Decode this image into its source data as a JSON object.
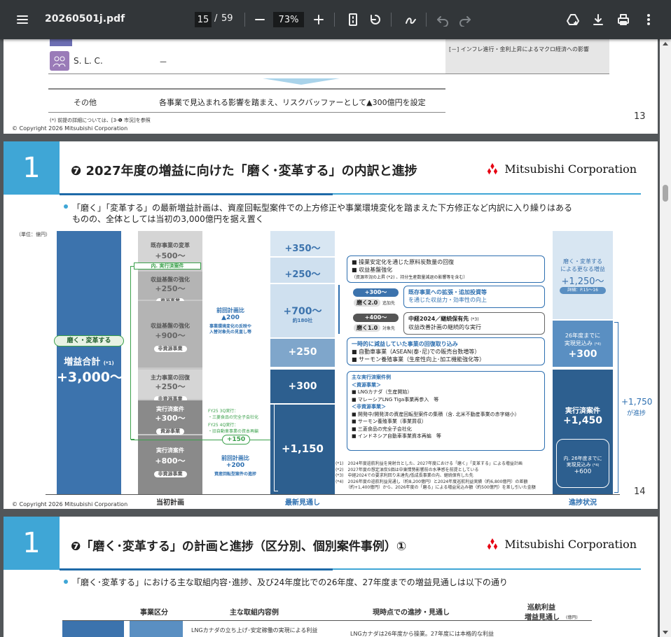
{
  "toolbar": {
    "menu_icon": "hamburger-icon",
    "filename": "20260501j.pdf",
    "page_current": "15",
    "page_sep": "/",
    "page_total": "59",
    "zoom": "73%"
  },
  "page13": {
    "slc_label": "S. L. C.",
    "slc_value": "－",
    "right_note": "[－] インフレ進行・金利上昇によるマクロ経済への影響",
    "other_label": "その他",
    "other_text": "各事業で見込まれる影響を踏まえ、リスクバッファーとして▲300億円を設定",
    "footnote": "(*) 前提の詳細については、[3-❶ 市況]を参照",
    "copyright": "© Copyright 2026 Mitsubishi Corporation",
    "page_number": "13"
  },
  "page14": {
    "section_number": "1",
    "title": "❼ 2027年度の増益に向けた「磨く･変革する」の内訳と進捗",
    "logo_text": "Mitsubishi Corporation",
    "bullet_line1": "「磨く」「変革する」の最新増益計画は、資産回転型案件での上方修正や事業環境変化を踏まえた下方修正など内訳に入り繰りはある",
    "bullet_line2": "ものの、全体としては当初の3,000億円を据え置く",
    "unit": "（単位：億円）",
    "left_badge": "磨く・変革する",
    "left_total_label": "増益合計",
    "left_total_note": "(*1)",
    "left_total_value": "+3,000～",
    "initial": [
      {
        "label": "既存事業の変革",
        "value": "+500～",
        "tag": ""
      },
      {
        "label": "内. 実行済案件",
        "value": "",
        "tag": ""
      },
      {
        "label": "収益基盤の強化",
        "value": "+250～",
        "tag": "資源事業"
      },
      {
        "label": "収益基盤の強化",
        "value": "+900～",
        "tag": "非資源事業"
      },
      {
        "label": "主力事業の回復",
        "value": "+250～",
        "tag": "非資源事業"
      },
      {
        "label": "実行済案件",
        "value": "+300～",
        "tag": "資源事業"
      },
      {
        "label": "実行済案件",
        "value": "+800～",
        "tag": "非資源事業"
      }
    ],
    "prev_compare_1": "前回計画比",
    "prev_compare_1_value": "▲200",
    "prev_compare_1_note1": "事業環境変化の反映や",
    "prev_compare_1_note2": "入替対象先の見直し等",
    "fy25_q3": "FY25 3Q実行：",
    "fy25_q3_item": "・三菱食品の完全子会社化",
    "fy25_q4": "FY25 4Q実行：",
    "fy25_q4_item": "・旧自動車事業の資本再編",
    "plus150": "+150",
    "prev_compare_2": "前回計画比",
    "prev_compare_2_value": "+200",
    "prev_compare_2_note": "資産回転型案件の進捗",
    "latest": [
      {
        "value": "+350～"
      },
      {
        "value": "+250～"
      },
      {
        "value": "+700～",
        "sub": "約180社"
      },
      {
        "value": "+250"
      },
      {
        "value": "+300"
      },
      {
        "value": "+1,150"
      }
    ],
    "callout1_line1": "■ 操業安定化を通じた原料炭数量の回復",
    "callout1_line2": "■ 収益基盤強化",
    "callout1_line3": "（資源市況の上昇 (*2) 、持分生産数量減退の影響等を含む）",
    "expand_label": "+300～",
    "expand_sub": "磨く2.0",
    "expand_sub2": "追加先",
    "callout2_line1": "既存事業への拡張・追加投資等",
    "callout2_line2": "を通じた収益力・効率性の向上",
    "mid_label": "+400～",
    "mid_sub": "磨く1.0",
    "mid_sub2": "対象先",
    "callout3_line1": "中経2024／継続保有先",
    "callout3_note": "(*3)",
    "callout3_line2": "収益改善計画の継続的な実行",
    "callout4_line1": "一時的に減益していた事業の回復取り込み",
    "callout4_line2": "■ 自動車事業（ASEAN(泰･尼)での販売台数増等）",
    "callout4_line3": "■ サーモン養殖事業（生産性向上･加工機能強化等）",
    "callout5_title": "主な実行済案件例",
    "callout5_res": "＜資源事業＞",
    "callout5_items_res": [
      "■ LNGカナダ（生産開始）",
      "■ マレーシアLNG Tiga事業再参入　等"
    ],
    "callout5_nonres": "＜非資源事業＞",
    "callout5_items_nonres": [
      "■ 開発中/開発済の資産回転型案件の集積（含. 北米不動産事業の赤字縮小）",
      "■ サーモン養殖事業（事業買収）",
      "■ 三菱食品の完全子会社化",
      "■ インドネシア自動車事業資本再編　等"
    ],
    "progress_top_line1": "磨く・変革する",
    "progress_top_line2": "による更なる増益",
    "progress_top_value": "+1,250～",
    "progress_top_note": "詳細：P.15～16",
    "progress_mid_line1": "26年度までに",
    "progress_mid_line2": "実現見込み",
    "progress_mid_note": "(*4)",
    "progress_mid_value": "+300",
    "progress_done_label": "実行済案件",
    "progress_done_value": "+1,450",
    "progress_inner_line1": "内. 26年度までに",
    "progress_inner_line2": "実現見込み",
    "progress_inner_note": "(*4)",
    "progress_inner_value": "+600",
    "progress_side_value": "+1,750",
    "progress_side_label": "が進捗",
    "footnotes": [
      "(*1)　2024年度巡航利益を発射台とした、2027年度における「磨く」「変革する」による増益計画",
      "(*2)　2027年度の想定油炭S価は中東情勢影響前の水準感を前提としている",
      "(*3)　中経2024での要求利回り未達先/低成長事業の内、継続保有した先",
      "(*4)　2026年度の巡航利益見通し（約8,200億円）と2024年度巡航利益実績（約6,800億円）の差額",
      "　　　（約+1,400億円）から、2026年度の「磨る」による増益見込み額（約500億円）を差し引いた金額"
    ],
    "axis_initial": "当初計画",
    "axis_latest": "最新見通し",
    "axis_progress": "進捗状況",
    "copyright": "© Copyright 2026 Mitsubishi Corporation",
    "page_number": "14"
  },
  "page15": {
    "section_number": "1",
    "title": "❼「磨く･変革する」の計画と進捗（区分別、個別案件事例）①",
    "logo_text": "Mitsubishi Corporation",
    "bullet": "「磨く･変革する」における主な取組内容･進捗、及び24年度比での26年度、27年度までの増益見通しは以下の通り",
    "col1": "事業区分",
    "col2": "主な取組内容例",
    "col3": "現時点での進捗・見通し",
    "col4_line1": "巡航利益",
    "col4_line2": "増益見通し",
    "col4_unit": "(億円)",
    "row1_c2": "LNGカナダの立ち上げ･安定稼働の実現による利益",
    "row1_c3": "LNGカナダは26年度から操業。27年度には本格的な利益"
  },
  "colors": {
    "toolbar_bg": "#323639",
    "viewer_bg": "#525659",
    "accent_blue": "#3fa6d6",
    "navy": "#2d5f8f",
    "mc_red": "#e60012"
  }
}
